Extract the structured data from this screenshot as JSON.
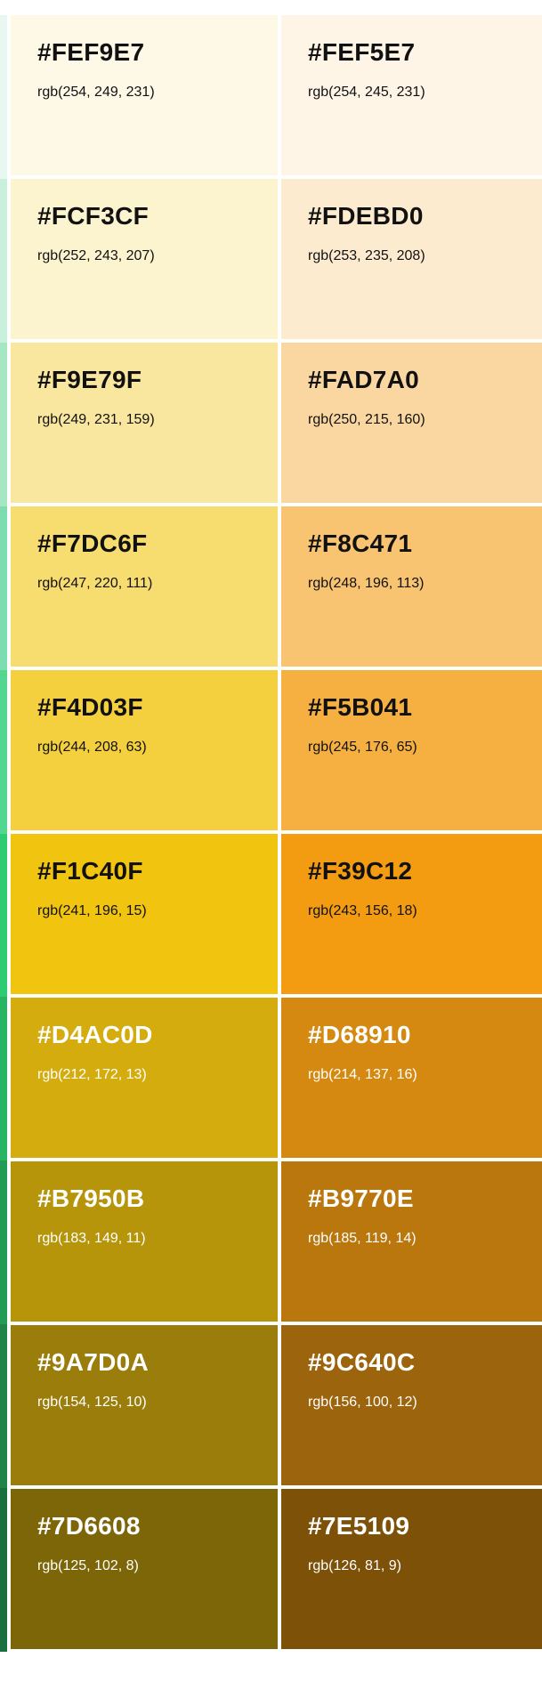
{
  "edge_colors": [
    "#e8f8f0",
    "#c9f0dc",
    "#a5e6c3",
    "#7dddb0",
    "#52d690",
    "#2ecc71",
    "#27b463",
    "#229b55",
    "#1e8449",
    "#196f3d"
  ],
  "swatches": [
    {
      "hex": "#FEF9E7",
      "rgb": "rgb(254, 249, 231)",
      "color": "#FEF9E7",
      "text": "dark"
    },
    {
      "hex": "#FEF5E7",
      "rgb": "rgb(254, 245, 231)",
      "color": "#FEF5E7",
      "text": "dark"
    },
    {
      "hex": "#FCF3CF",
      "rgb": "rgb(252, 243, 207)",
      "color": "#FCF3CF",
      "text": "dark"
    },
    {
      "hex": "#FDEBD0",
      "rgb": "rgb(253, 235, 208)",
      "color": "#FDEBD0",
      "text": "dark"
    },
    {
      "hex": "#F9E79F",
      "rgb": "rgb(249, 231, 159)",
      "color": "#F9E79F",
      "text": "dark"
    },
    {
      "hex": "#FAD7A0",
      "rgb": "rgb(250, 215, 160)",
      "color": "#FAD7A0",
      "text": "dark"
    },
    {
      "hex": "#F7DC6F",
      "rgb": "rgb(247, 220, 111)",
      "color": "#F7DC6F",
      "text": "dark"
    },
    {
      "hex": "#F8C471",
      "rgb": "rgb(248, 196, 113)",
      "color": "#F8C471",
      "text": "dark"
    },
    {
      "hex": "#F4D03F",
      "rgb": "rgb(244, 208, 63)",
      "color": "#F4D03F",
      "text": "dark"
    },
    {
      "hex": "#F5B041",
      "rgb": "rgb(245, 176, 65)",
      "color": "#F5B041",
      "text": "dark"
    },
    {
      "hex": "#F1C40F",
      "rgb": "rgb(241, 196, 15)",
      "color": "#F1C40F",
      "text": "dark"
    },
    {
      "hex": "#F39C12",
      "rgb": "rgb(243, 156, 18)",
      "color": "#F39C12",
      "text": "dark"
    },
    {
      "hex": "#D4AC0D",
      "rgb": "rgb(212, 172, 13)",
      "color": "#D4AC0D",
      "text": "light"
    },
    {
      "hex": "#D68910",
      "rgb": "rgb(214, 137, 16)",
      "color": "#D68910",
      "text": "light"
    },
    {
      "hex": "#B7950B",
      "rgb": "rgb(183, 149, 11)",
      "color": "#B7950B",
      "text": "light"
    },
    {
      "hex": "#B9770E",
      "rgb": "rgb(185, 119, 14)",
      "color": "#B9770E",
      "text": "light"
    },
    {
      "hex": "#9A7D0A",
      "rgb": "rgb(154, 125, 10)",
      "color": "#9A7D0A",
      "text": "light"
    },
    {
      "hex": "#9C640C",
      "rgb": "rgb(156, 100, 12)",
      "color": "#9C640C",
      "text": "light"
    },
    {
      "hex": "#7D6608",
      "rgb": "rgb(125, 102, 8)",
      "color": "#7D6608",
      "text": "light"
    },
    {
      "hex": "#7E5109",
      "rgb": "rgb(126, 81, 9)",
      "color": "#7E5109",
      "text": "light"
    }
  ]
}
